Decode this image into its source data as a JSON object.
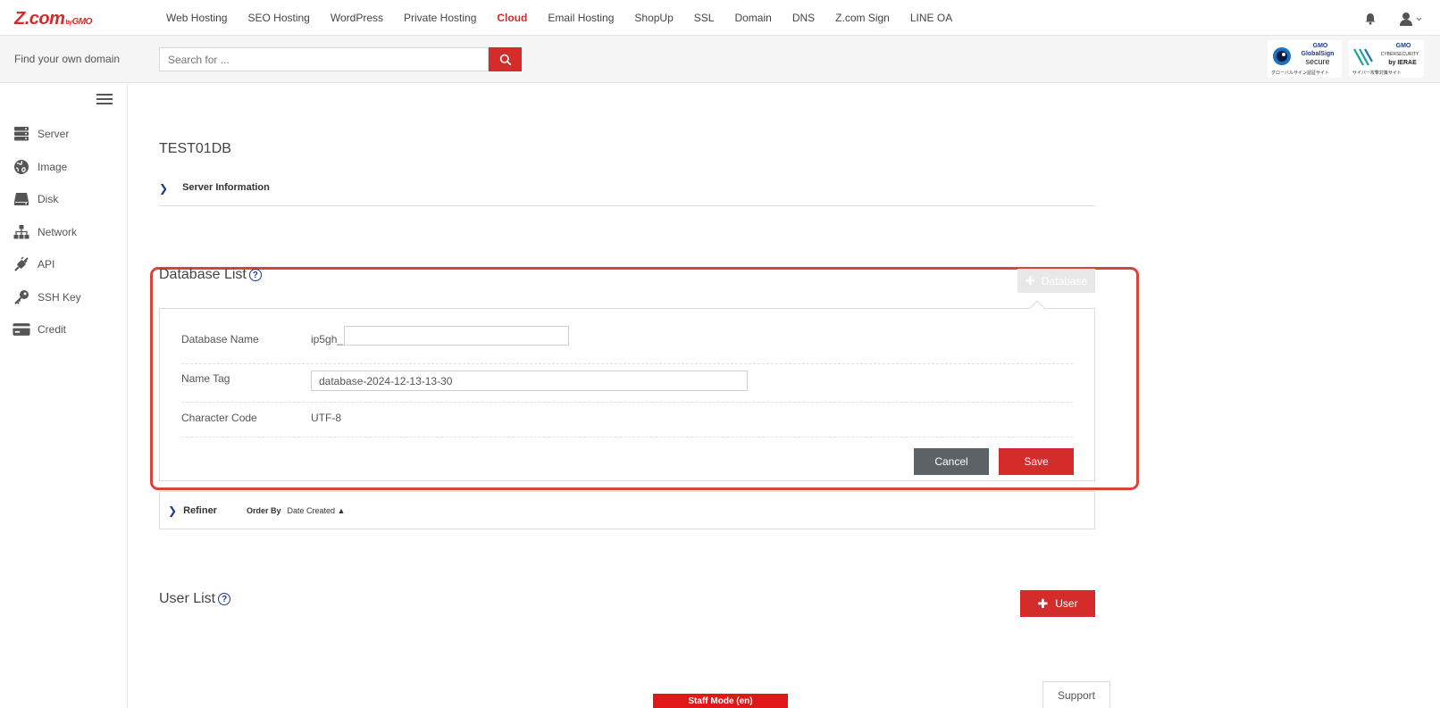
{
  "header": {
    "logo_main": "Z.com",
    "logo_by": "by",
    "logo_gmo": "GMO",
    "nav": [
      "Web Hosting",
      "SEO Hosting",
      "WordPress",
      "Private Hosting",
      "Cloud",
      "Email Hosting",
      "ShopUp",
      "SSL",
      "Domain",
      "DNS",
      "Z.com Sign",
      "LINE OA"
    ],
    "active_nav": "Cloud"
  },
  "subheader": {
    "find_label": "Find your own domain",
    "search_placeholder": "Search for ...",
    "badge1": {
      "title_1": "GMO",
      "title_2": "GlobalSign",
      "title_3": "secure",
      "sub": "グローバルサイン認証サイト"
    },
    "badge2": {
      "title_1": "GMO",
      "title_2": "CYBERSECURITY",
      "title_3": "by IERAE",
      "sub": "サイバー攻撃対策サイト"
    }
  },
  "sidebar": {
    "items": [
      {
        "label": "Server",
        "icon": "server-icon"
      },
      {
        "label": "Image",
        "icon": "globe-icon"
      },
      {
        "label": "Disk",
        "icon": "disk-icon"
      },
      {
        "label": "Network",
        "icon": "network-icon"
      },
      {
        "label": "API",
        "icon": "api-icon"
      },
      {
        "label": "SSH Key",
        "icon": "key-icon"
      },
      {
        "label": "Credit",
        "icon": "credit-card-icon"
      }
    ]
  },
  "main": {
    "page_title": "TEST01DB",
    "server_info_label": "Server Information",
    "database_list_title": "Database List",
    "add_database_label": "Database",
    "form": {
      "db_name_label": "Database Name",
      "db_name_prefix": "ip5gh_",
      "db_name_value": "",
      "name_tag_label": "Name Tag",
      "name_tag_value": "database-2024-12-13-13-30",
      "charset_label": "Character Code",
      "charset_value": "UTF-8",
      "cancel_label": "Cancel",
      "save_label": "Save"
    },
    "refiner": {
      "label": "Refiner",
      "order_by_label": "Order By",
      "order_by_value": "Date Created ▲"
    },
    "user_list_title": "User List",
    "add_user_label": "User"
  },
  "footer": {
    "staff_mode": "Staff Mode (en)",
    "support": "Support"
  },
  "colors": {
    "brand_red": "#d42b2b",
    "highlight_border": "#d9443a",
    "navy": "#1d3a8a",
    "cancel_gray": "#5c6366"
  }
}
